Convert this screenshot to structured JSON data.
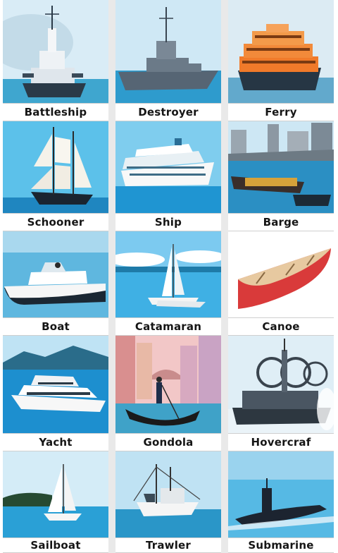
{
  "grid": {
    "rows": [
      [
        "Battleship",
        "Destroyer",
        "Ferry"
      ],
      [
        "Schooner",
        "Ship",
        "Barge"
      ],
      [
        "Boat",
        "Catamaran",
        "Canoe"
      ],
      [
        "Yacht",
        "Gondola",
        "Hovercraf"
      ],
      [
        "Sailboat",
        "Trawler",
        "Submarine"
      ]
    ]
  },
  "colors": {
    "sea": "#2aa6d8",
    "sky": "#d8eef8",
    "canoe": "#d93a3a",
    "ferry": "#f07a2a"
  }
}
